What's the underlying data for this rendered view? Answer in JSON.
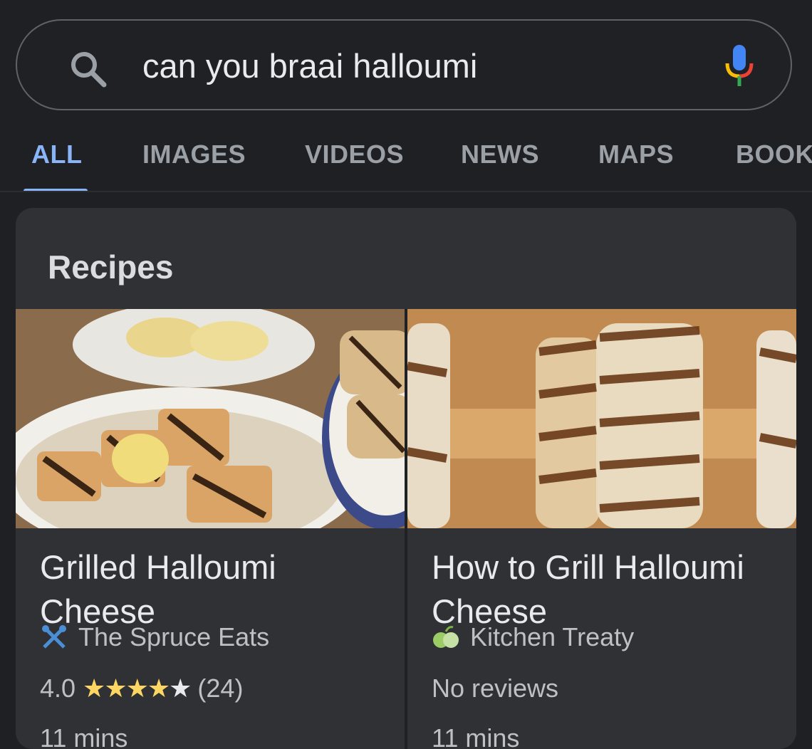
{
  "search": {
    "query": "can you braai halloumi",
    "search_icon": "search-icon",
    "mic_icon": "microphone-icon"
  },
  "tabs": [
    {
      "label": "ALL",
      "active": true
    },
    {
      "label": "IMAGES",
      "active": false
    },
    {
      "label": "VIDEOS",
      "active": false
    },
    {
      "label": "NEWS",
      "active": false
    },
    {
      "label": "MAPS",
      "active": false
    },
    {
      "label": "BOOK",
      "active": false
    }
  ],
  "recipes_card": {
    "title": "Recipes",
    "items": [
      {
        "title": "Grilled Halloumi Cheese",
        "source": "The Spruce Eats",
        "source_icon": "utensils-icon",
        "rating": "4.0",
        "stars": "★★★★",
        "star_last": "★",
        "review_count": "(24)",
        "time": "11 mins"
      },
      {
        "title": "How to Grill Halloumi Cheese",
        "source": "Kitchen Treaty",
        "source_icon": "fruit-icon",
        "reviews": "No reviews",
        "time": "11 mins"
      }
    ]
  },
  "colors": {
    "background": "#1f2023",
    "card": "#303134",
    "accent": "#8ab4f8",
    "star": "#fdd663"
  }
}
